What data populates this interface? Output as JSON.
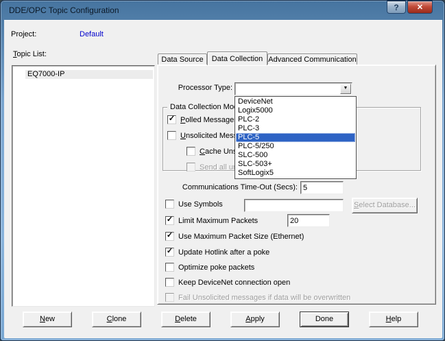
{
  "window": {
    "title": "DDE/OPC Topic Configuration"
  },
  "icons": {
    "help": "?",
    "close": "✕",
    "dropdown_arrow": "▼",
    "check": "✓"
  },
  "project": {
    "label": "Project:",
    "value": "Default"
  },
  "topic_list": {
    "label": "Topic List:",
    "items": [
      "EQ7000-IP"
    ]
  },
  "tabs": [
    {
      "label": "Data Source",
      "active": false
    },
    {
      "label": "Data Collection",
      "active": true
    },
    {
      "label": "Advanced Communication",
      "active": false
    }
  ],
  "data_collection_tab": {
    "processor_type": {
      "label": "Processor Type:",
      "value": "",
      "options": [
        "DeviceNet",
        "Logix5000",
        "PLC-2",
        "PLC-3",
        "PLC-5",
        "PLC-5/250",
        "SLC-500",
        "SLC-503+",
        "SoftLogix5"
      ],
      "selected_option": "PLC-5"
    },
    "mode_group": {
      "label": "Data Collection Mod",
      "checkboxes": [
        {
          "label": "Polled Messages",
          "checked": true,
          "disabled": false
        },
        {
          "label": "Unsolicited Mess",
          "checked": false,
          "disabled": false
        },
        {
          "label": "Cache Uns",
          "checked": false,
          "disabled": false
        },
        {
          "label": "Send all un",
          "checked": false,
          "disabled": true
        }
      ]
    },
    "timeout": {
      "label": "Communications Time-Out (Secs):",
      "value": "5"
    },
    "use_symbols": {
      "label": "Use Symbols",
      "checked": false,
      "value": "",
      "button_label": "Select Database...",
      "button_disabled": true
    },
    "limit_packets": {
      "label": "Limit Maximum Packets",
      "checked": true,
      "value": "20"
    },
    "max_packet_size": {
      "label": "Use Maximum Packet Size (Ethernet)",
      "checked": true
    },
    "update_hotlink": {
      "label": "Update Hotlink after a poke",
      "checked": true
    },
    "optimize_poke": {
      "label": "Optimize poke packets",
      "checked": false
    },
    "keep_devicenet": {
      "label": "Keep DeviceNet connection open",
      "checked": false
    },
    "fail_unsolicited": {
      "label": "Fail Unsolicited messages if data will be overwritten",
      "checked": false,
      "disabled": true
    }
  },
  "buttons": [
    {
      "label": "New"
    },
    {
      "label": "Clone"
    },
    {
      "label": "Delete"
    },
    {
      "label": "Apply"
    },
    {
      "label": "Done",
      "default": true
    },
    {
      "label": "Help"
    }
  ],
  "colors": {
    "titlebar_top": "#46749f",
    "titlebar_bottom": "#8ab4dc",
    "close_red": "#a83226",
    "client_bg": "#f0f0f0",
    "highlight": "#2e63c4",
    "link_blue": "#0000cc",
    "disabled_text": "#9c9c9c"
  }
}
